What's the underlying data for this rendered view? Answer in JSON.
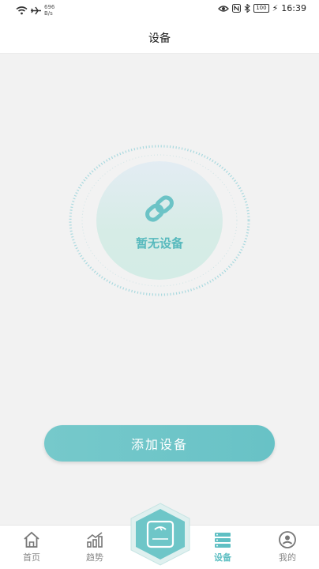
{
  "status_bar": {
    "net_speed_value": "696",
    "net_speed_unit": "B/s",
    "battery": "100",
    "time": "16:39"
  },
  "header": {
    "title": "设备"
  },
  "empty_state": {
    "text": "暂无设备"
  },
  "add_button": {
    "label": "添加设备"
  },
  "tabs": [
    {
      "label": "首页",
      "icon": "home-icon",
      "active": false
    },
    {
      "label": "趋势",
      "icon": "trend-chart-icon",
      "active": false
    },
    {
      "label": "",
      "icon": "scale-icon",
      "active": false
    },
    {
      "label": "设备",
      "icon": "device-list-icon",
      "active": true
    },
    {
      "label": "我的",
      "icon": "profile-icon",
      "active": false
    }
  ],
  "colors": {
    "accent": "#5fbfc3",
    "button": "#6ec6c8",
    "background": "#f2f2f2"
  }
}
